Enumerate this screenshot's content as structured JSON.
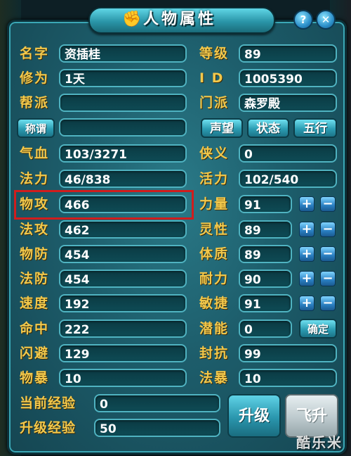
{
  "title": "人物属性",
  "title_icon": "hand-rock-icon",
  "colors": {
    "label": "#f2c84b",
    "panel": "#1d5d6b",
    "field_border": "#4fb3c1",
    "highlight": "#d01d1d"
  },
  "buttons": {
    "help": "?",
    "close": "✕"
  },
  "left": {
    "name": {
      "label": "名字",
      "value": "资插桂"
    },
    "cultivation": {
      "label": "修为",
      "value": "1天"
    },
    "guild": {
      "label": "帮派",
      "value": ""
    },
    "title_btn": {
      "label": "称谓",
      "value": ""
    },
    "hp": {
      "label": "气血",
      "value": "103/3271"
    },
    "mp": {
      "label": "法力",
      "value": "46/838"
    },
    "phys_atk": {
      "label": "物攻",
      "value": "466"
    },
    "mag_atk": {
      "label": "法攻",
      "value": "462"
    },
    "phys_def": {
      "label": "物防",
      "value": "454"
    },
    "mag_def": {
      "label": "法防",
      "value": "454"
    },
    "speed": {
      "label": "速度",
      "value": "192"
    },
    "hit": {
      "label": "命中",
      "value": "222"
    },
    "dodge": {
      "label": "闪避",
      "value": "129"
    },
    "phys_crit": {
      "label": "物暴",
      "value": "10"
    }
  },
  "right": {
    "level": {
      "label": "等级",
      "value": "89"
    },
    "id": {
      "label": "I D",
      "value": "1005390"
    },
    "sect": {
      "label": "门派",
      "value": "森罗殿"
    },
    "reputation_btn": "声望",
    "status_btn": "状态",
    "elements_btn": "五行",
    "chivalry": {
      "label": "侠义",
      "value": "0"
    },
    "vitality": {
      "label": "活力",
      "value": "102/540"
    },
    "strength": {
      "label": "力量",
      "value": "91"
    },
    "spirit": {
      "label": "灵性",
      "value": "89"
    },
    "constitution": {
      "label": "体质",
      "value": "89"
    },
    "endurance": {
      "label": "耐力",
      "value": "90"
    },
    "agility": {
      "label": "敏捷",
      "value": "91"
    },
    "potential": {
      "label": "潜能",
      "value": "0"
    },
    "confirm_btn": "确定",
    "seal_resist": {
      "label": "封抗",
      "value": "99"
    },
    "mag_crit": {
      "label": "法暴",
      "value": "10"
    }
  },
  "exp": {
    "current": {
      "label": "当前经验",
      "value": "0"
    },
    "upgrade": {
      "label": "升级经验",
      "value": "50"
    }
  },
  "upgrade_btn": "升级",
  "ascend_btn": "飞升",
  "plus": "+",
  "minus": "−",
  "watermark": "酷乐米"
}
